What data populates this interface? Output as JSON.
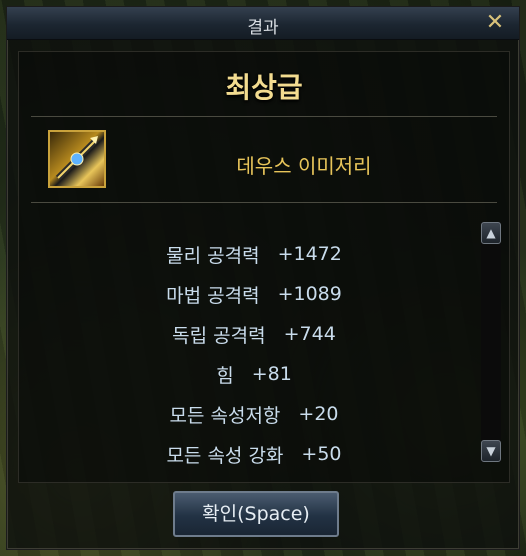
{
  "window": {
    "title": "결과"
  },
  "result": {
    "grade": "최상급",
    "item_name": "데우스 이미저리",
    "icon": "weapon-icon"
  },
  "stats": [
    {
      "name": "물리 공격력",
      "value": "+1472"
    },
    {
      "name": "마법 공격력",
      "value": "+1089"
    },
    {
      "name": "독립 공격력",
      "value": "+744"
    },
    {
      "name": "힘",
      "value": "+81"
    },
    {
      "name": "모든 속성저항",
      "value": "+20"
    },
    {
      "name": "모든 속성 강화",
      "value": "+50"
    }
  ],
  "confirm_button": {
    "label": "확인(Space)"
  },
  "colors": {
    "grade": "#f3dc90",
    "item_name": "#e8c55a",
    "stat_text": "#c9dcec",
    "close": "#d9c27a"
  }
}
